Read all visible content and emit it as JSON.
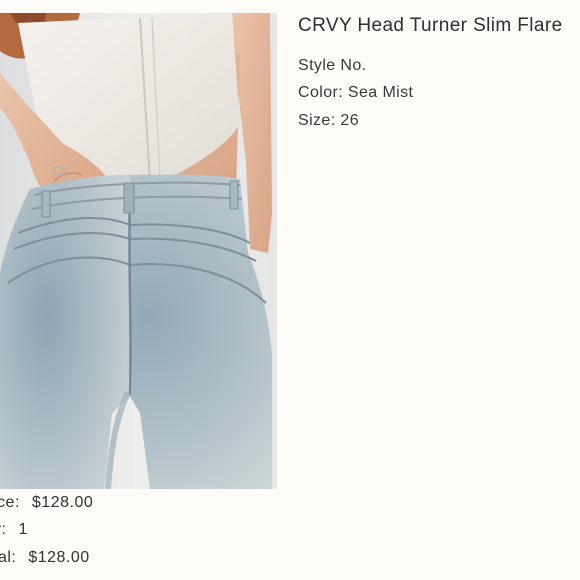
{
  "product": {
    "title": "CRVY Head Turner Slim Flare",
    "image_alt": "back view of woman wearing light wash flare jeans",
    "style_label": "Style No.",
    "color_label": "Color: Sea Mist",
    "size_label": "Size: 26"
  },
  "summary": {
    "price_label": "ice:",
    "price_value": "$128.00",
    "qty_label": "y:",
    "qty_value": "1",
    "total_label": "tal:",
    "total_value": "$128.00"
  },
  "colors": {
    "background": "#fcfbf8",
    "denim": "#a9bcc6",
    "top": "#efebe6",
    "skin": "#e3b79c",
    "hair": "#b36a3e"
  }
}
